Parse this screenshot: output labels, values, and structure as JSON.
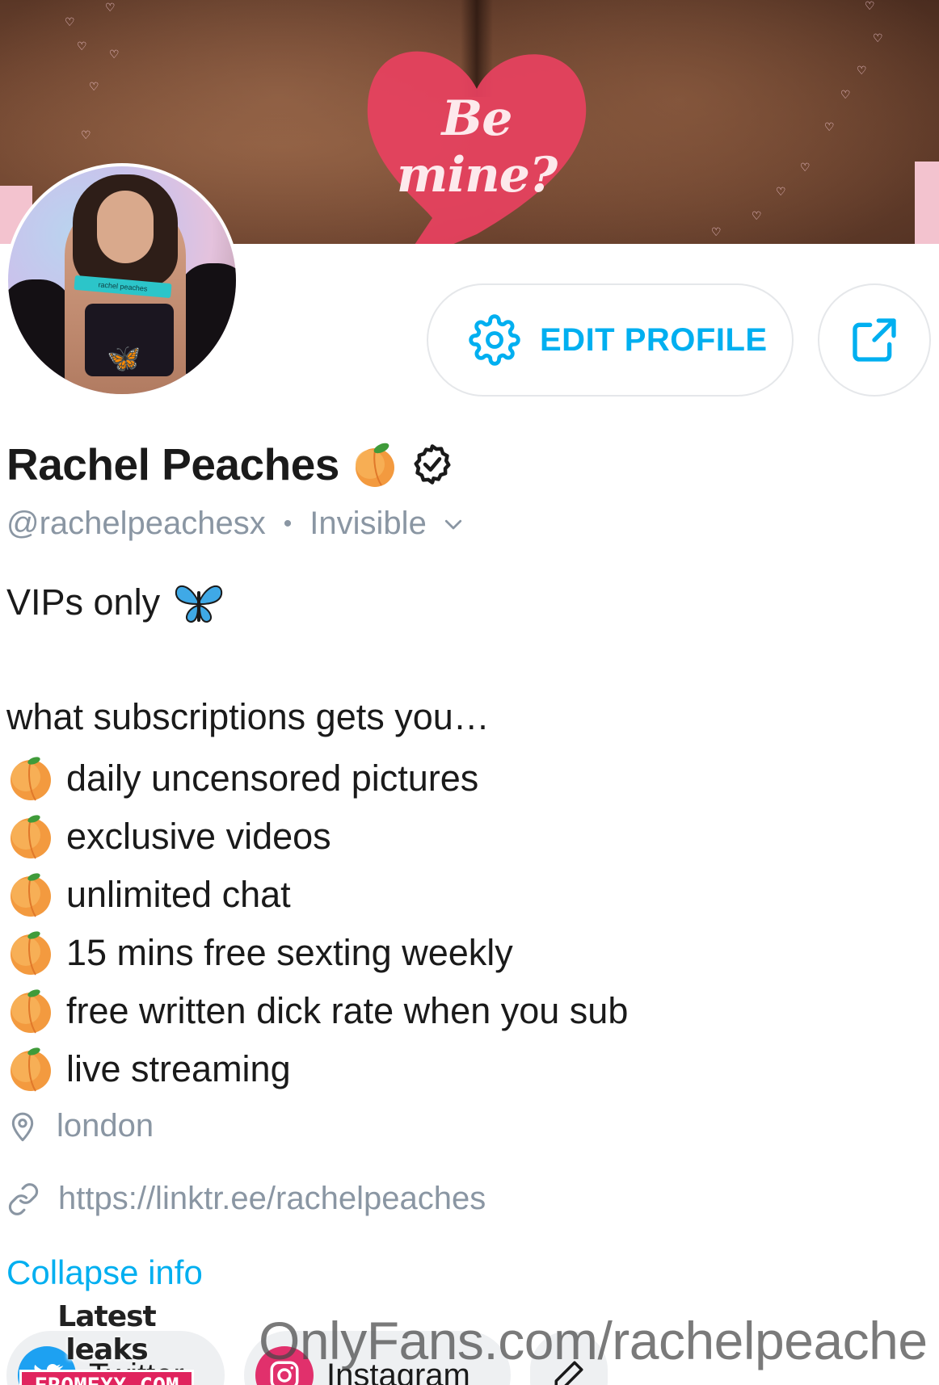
{
  "cover": {
    "bubble_text": "Be mine?"
  },
  "profile": {
    "name": "Rachel Peaches",
    "handle": "@rachelpeachesx",
    "separator": "•",
    "status": "Invisible",
    "avatar_label": "rachel peaches"
  },
  "actions": {
    "edit_profile_label": "EDIT PROFILE"
  },
  "bio": {
    "headline": "VIPs only",
    "intro": "what subscriptions gets you…",
    "items": [
      "daily uncensored pictures",
      "exclusive videos",
      "unlimited chat",
      "15 mins free sexting weekly",
      "free written dick rate when you sub",
      "live streaming"
    ]
  },
  "meta": {
    "location": "london",
    "website": "https://linktr.ee/rachelpeaches"
  },
  "collapse_label": "Collapse info",
  "socials": [
    {
      "label": "Twitter",
      "icon": "twitter-icon"
    },
    {
      "label": "Instagram",
      "icon": "instagram-icon"
    }
  ],
  "watermarks": {
    "url": "OnlyFans.com/rachelpeache",
    "badge_top": "Latest leaks",
    "badge_bottom": "EROMEXX.COM"
  },
  "colors": {
    "accent": "#00aff0",
    "muted": "#8a96a3",
    "text": "#1a1a1a",
    "bubble": "#e8415f"
  }
}
